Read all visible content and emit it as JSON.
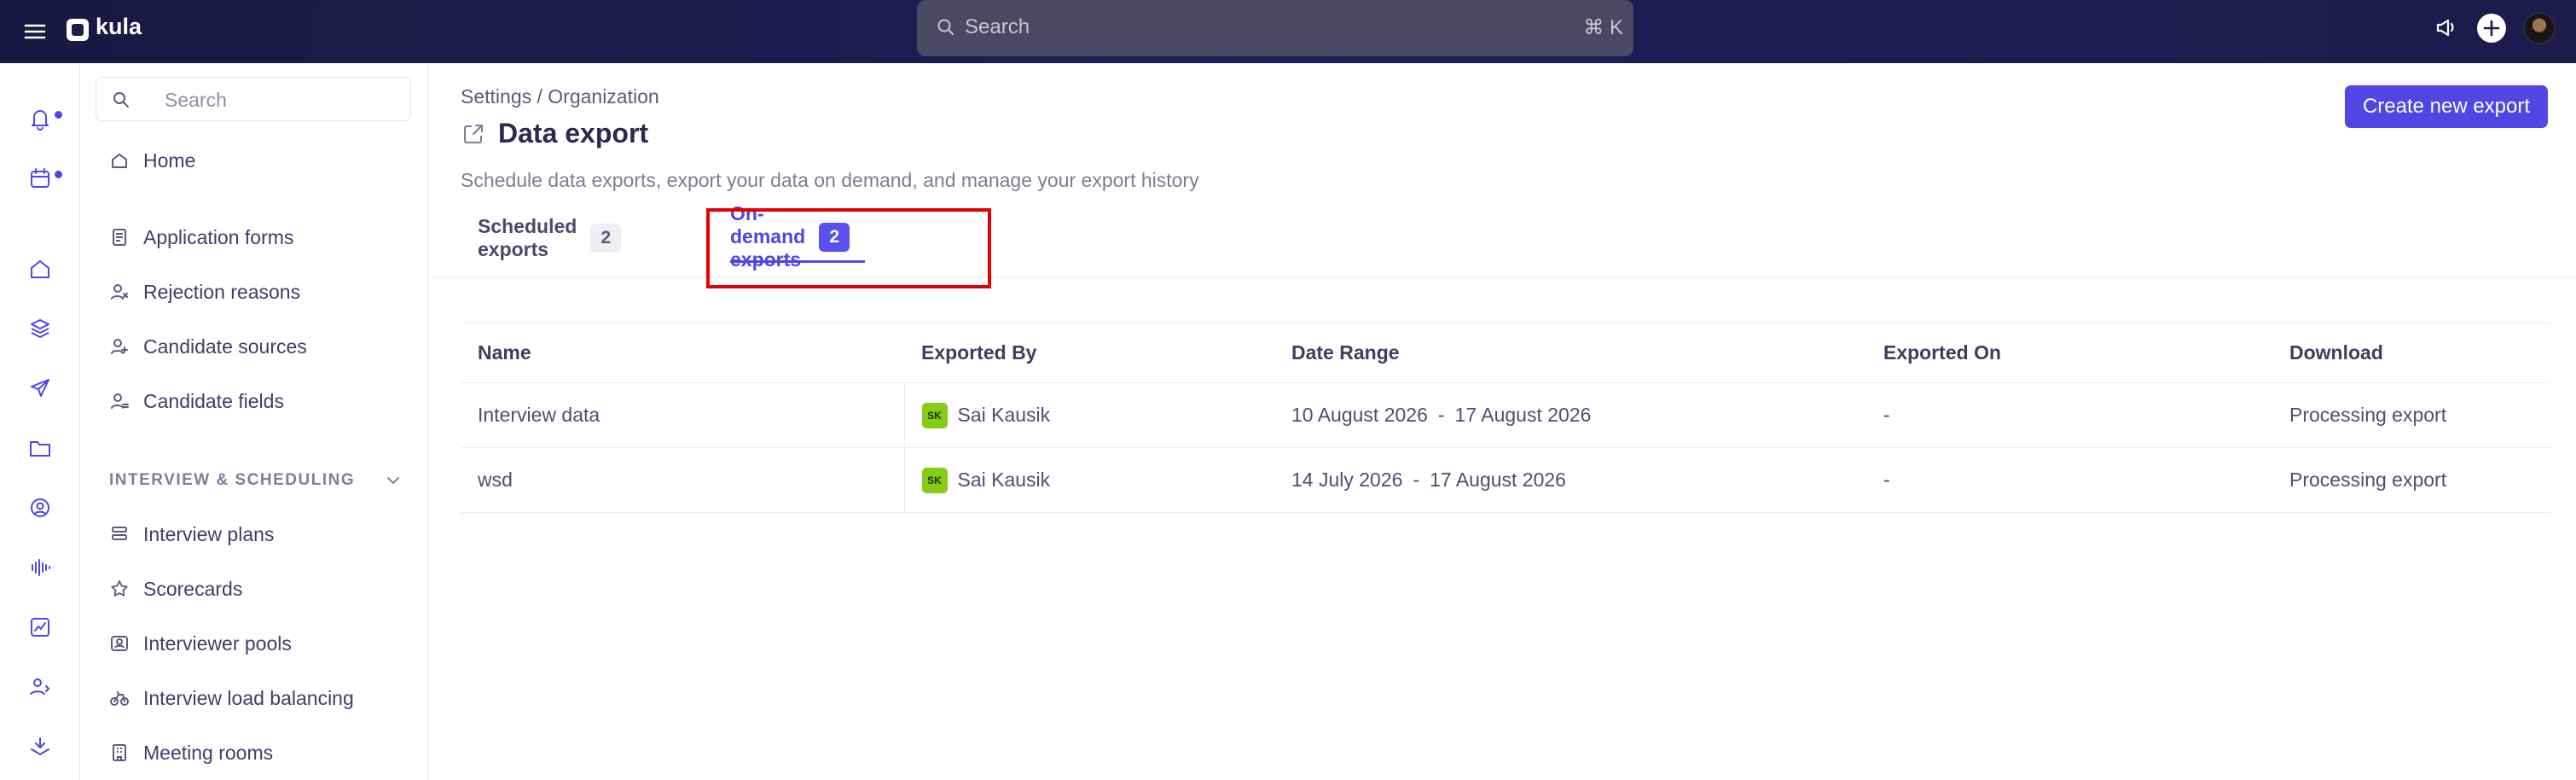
{
  "app": {
    "name": "kula"
  },
  "topbar": {
    "search_placeholder": "Search",
    "search_shortcut": "⌘ K"
  },
  "sidebar": {
    "search_placeholder": "Search",
    "items": [
      {
        "label": "Home",
        "icon": "home-icon"
      },
      {
        "label": "Application forms",
        "icon": "document-icon"
      },
      {
        "label": "Rejection reasons",
        "icon": "user-x-icon"
      },
      {
        "label": "Candidate sources",
        "icon": "user-source-icon"
      },
      {
        "label": "Candidate fields",
        "icon": "user-fields-icon"
      }
    ],
    "section": {
      "label": "INTERVIEW & SCHEDULING",
      "items": [
        {
          "label": "Interview plans",
          "icon": "plan-icon"
        },
        {
          "label": "Scorecards",
          "icon": "star-icon"
        },
        {
          "label": "Interviewer pools",
          "icon": "pool-icon"
        },
        {
          "label": "Interview load balancing",
          "icon": "bike-icon"
        },
        {
          "label": "Meeting rooms",
          "icon": "building-icon"
        }
      ]
    }
  },
  "page": {
    "breadcrumb": "Settings / Organization",
    "title": "Data export",
    "subtitle": "Schedule data exports, export your data on demand, and manage your export history",
    "create_button": "Create new export"
  },
  "tabs": [
    {
      "label": "Scheduled exports",
      "count": "2",
      "active": false
    },
    {
      "label": "On-demand exports",
      "count": "2",
      "active": true
    }
  ],
  "table": {
    "columns": [
      "Name",
      "Exported By",
      "Date Range",
      "Exported On",
      "Download"
    ],
    "rows": [
      {
        "name": "Interview data",
        "by_initials": "SK",
        "by": "Sai Kausik",
        "range_start": "10 August 2026",
        "range_sep": "-",
        "range_end": "17 August 2026",
        "exported_on": "-",
        "download": "Processing export"
      },
      {
        "name": "wsd",
        "by_initials": "SK",
        "by": "Sai Kausik",
        "range_start": "14 July 2026",
        "range_sep": "-",
        "range_end": "17 August 2026",
        "exported_on": "-",
        "download": "Processing export"
      }
    ]
  },
  "colors": {
    "accent": "#4f46e5",
    "topbar": "#1e1b4b",
    "highlight": "#e60000",
    "avatar_bg": "#84cc16"
  }
}
